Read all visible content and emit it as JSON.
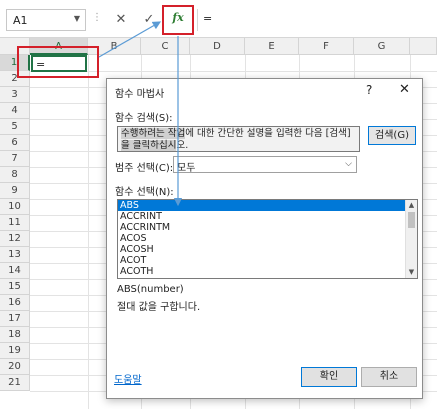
{
  "formula_bar": {
    "cell_ref": "A1",
    "cancel_symbol": "✕",
    "enter_symbol": "✓",
    "fx_label": "fx",
    "content": "="
  },
  "grid": {
    "columns": [
      "A",
      "B",
      "C",
      "D",
      "E",
      "F",
      "G"
    ],
    "rows": [
      "1",
      "2",
      "3",
      "4",
      "5",
      "6",
      "7",
      "8",
      "9",
      "10",
      "11",
      "12",
      "13",
      "14",
      "15",
      "16",
      "17",
      "18",
      "19",
      "20",
      "21"
    ],
    "active_cell_value": "="
  },
  "dialog": {
    "title": "함수 마법사",
    "help": "?",
    "close": "✕",
    "search_label": "함수 검색(S):",
    "search_line1_pre": "수행하려는 작업",
    "search_line1_post": "에 대한 간단한 설명을 입력한 다음 [검색]",
    "search_line2_pre": "을 클릭하십시",
    "search_line2_post": "오.",
    "search_button": "검색(G)",
    "category_label": "범주 선택(C):",
    "category_value": "모두",
    "function_label": "함수 선택(N):",
    "functions": [
      "ABS",
      "ACCRINT",
      "ACCRINTM",
      "ACOS",
      "ACOSH",
      "ACOT",
      "ACOTH"
    ],
    "syntax": "ABS(number)",
    "description": "절대 값을 구합니다.",
    "help_link": "도움말",
    "ok_button": "확인",
    "cancel_button": "취소"
  },
  "colors": {
    "highlight_red": "#d4202a",
    "excel_green": "#217346",
    "arrow_blue": "#5b9bd5",
    "selection_blue": "#0078d7"
  }
}
